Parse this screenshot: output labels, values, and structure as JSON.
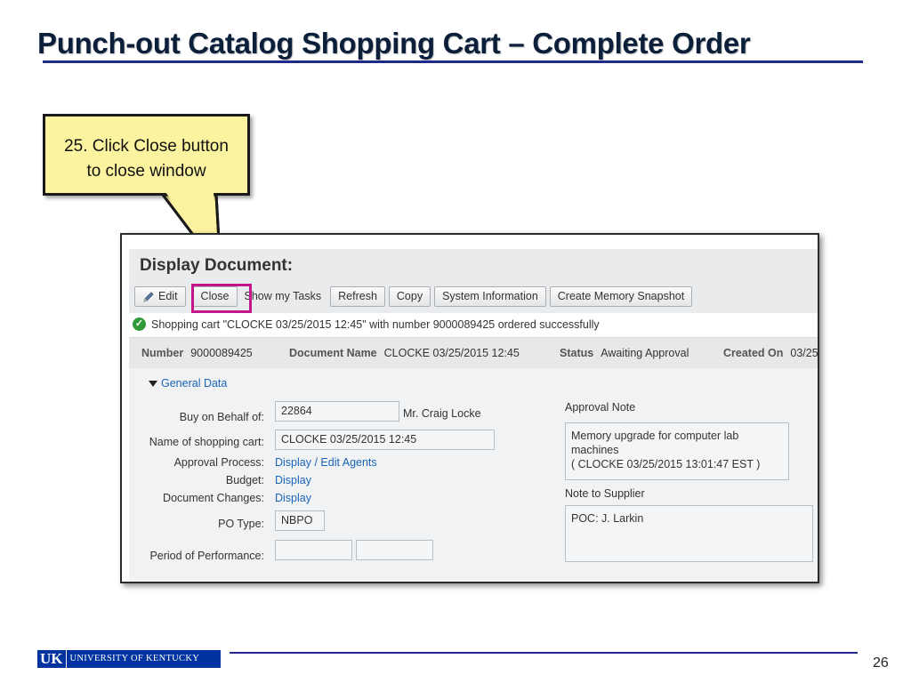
{
  "slide": {
    "title": "Punch-out Catalog Shopping Cart – Complete Order",
    "callout_line1": "25. Click Close button",
    "callout_line2": "to close window",
    "footer_logo_mark": "UK",
    "footer_logo_text": "UNIVERSITY OF KENTUCKY",
    "page_number": "26"
  },
  "document": {
    "title": "Display Document:",
    "toolbar": {
      "edit": "Edit",
      "close": "Close",
      "show_tasks": "Show my Tasks",
      "refresh": "Refresh",
      "copy": "Copy",
      "system_info": "System Information",
      "memory_snapshot": "Create Memory Snapshot"
    },
    "message": "Shopping cart \"CLOCKE 03/25/2015 12:45\" with number 9000089425 ordered successfully",
    "info": {
      "number_label": "Number",
      "number_value": "9000089425",
      "docname_label": "Document Name",
      "docname_value": "CLOCKE 03/25/2015 12:45",
      "status_label": "Status",
      "status_value": "Awaiting Approval",
      "created_label": "Created On",
      "created_value": "03/25"
    },
    "general_data": {
      "section_label": "General Data",
      "buy_on_behalf_label": "Buy on Behalf of:",
      "buy_on_behalf_value": "22864",
      "buy_on_behalf_name": "Mr. Craig Locke",
      "cart_name_label": "Name of shopping cart:",
      "cart_name_value": "CLOCKE 03/25/2015 12:45",
      "approval_process_label": "Approval Process:",
      "approval_process_link": "Display / Edit Agents",
      "budget_label": "Budget:",
      "budget_link": "Display",
      "doc_changes_label": "Document Changes:",
      "doc_changes_link": "Display",
      "po_type_label": "PO Type:",
      "po_type_value": "NBPO",
      "period_label": "Period of Performance:",
      "period_from": "",
      "period_to": "",
      "approval_note_label": "Approval Note",
      "approval_note_line1": "Memory upgrade for computer lab",
      "approval_note_line2": "machines",
      "approval_note_line3": "( CLOCKE 03/25/2015 13:01:47 EST )",
      "supplier_note_label": "Note to Supplier",
      "supplier_note_value": "POC: J. Larkin"
    }
  },
  "colors": {
    "title_rule": "#1f2a8a",
    "callout_fill": "#fbf39f",
    "highlight_border": "#c3178c",
    "link": "#1a64b8",
    "success": "#2e9a3a",
    "uk_blue": "#0033a0"
  },
  "icons": {
    "edit": "pencil-icon",
    "success": "check-circle-icon",
    "section_toggle": "triangle-down-icon"
  }
}
